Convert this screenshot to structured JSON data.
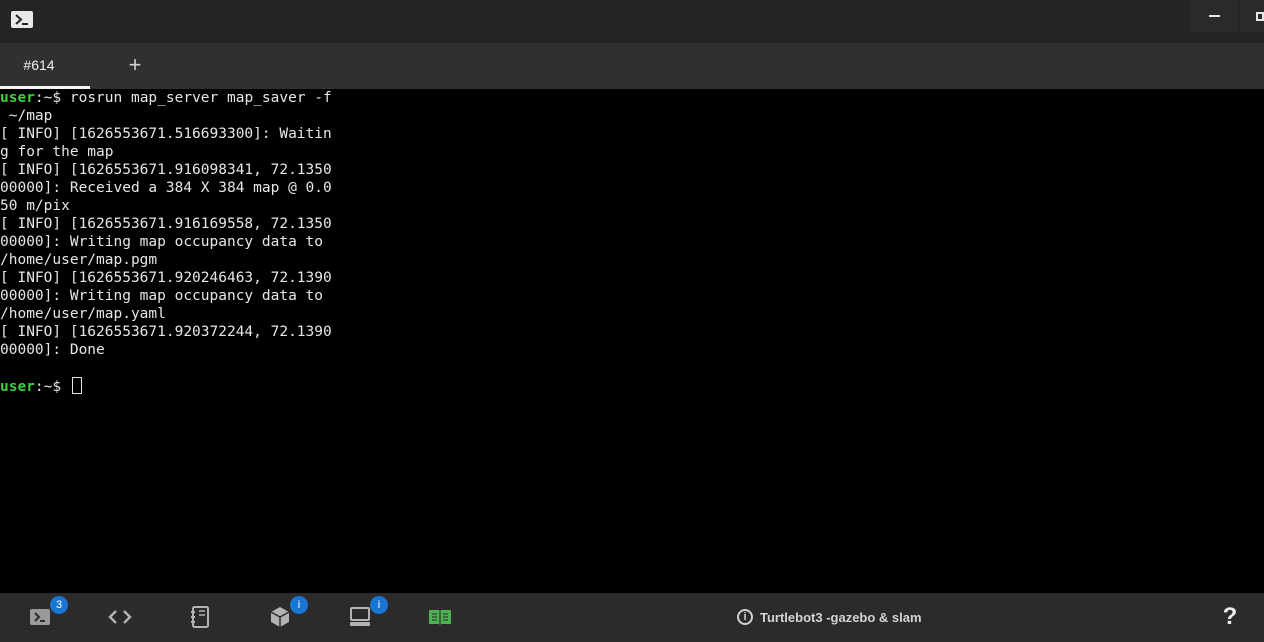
{
  "window": {
    "app_icon": "terminal-icon",
    "minimize_icon": "minimize-icon",
    "maximize_icon": "maximize-icon"
  },
  "tabs": {
    "active_label": "#614",
    "add_label": "+"
  },
  "terminal": {
    "prompt_user": "user",
    "prompt_rest": ":~$",
    "lines": [
      " ~/map",
      "[ INFO] [1626553671.516693300]: Waitin",
      "g for the map",
      "[ INFO] [1626553671.916098341, 72.1350",
      "00000]: Received a 384 X 384 map @ 0.0",
      "50 m/pix",
      "[ INFO] [1626553671.916169558, 72.1350",
      "00000]: Writing map occupancy data to",
      "/home/user/map.pgm",
      "[ INFO] [1626553671.920246463, 72.1390",
      "00000]: Writing map occupancy data to",
      "/home/user/map.yaml",
      "[ INFO] [1626553671.920372244, 72.1390",
      "00000]: Done",
      ""
    ],
    "command": " rosrun map_server map_saver -f"
  },
  "bottombar": {
    "shell_badge": "3",
    "editor_icon": "code-icon",
    "notebook_icon": "notebook-icon",
    "cube_badge": "i",
    "desktop_badge": "i",
    "book_icon": "book-icon",
    "info_icon": "i",
    "project_title": "Turtlebot3 -gazebo & slam",
    "help_label": "?",
    "accent_green": "#4caf50",
    "badge_blue": "#1976d2"
  }
}
